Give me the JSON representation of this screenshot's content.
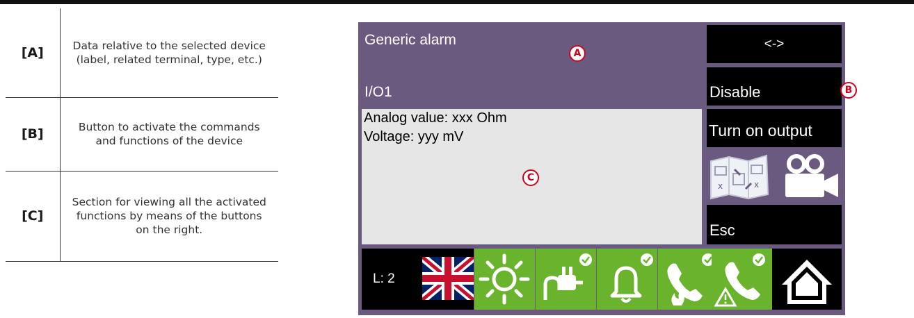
{
  "legend": [
    {
      "key": "[A]",
      "description": "Data relative to the selected device (label, related terminal, type, etc.)"
    },
    {
      "key": "[B]",
      "description": "Button to activate the commands and functions of the device"
    },
    {
      "key": "[C]",
      "description": "Section for viewing all the activated functions by means of the buttons on the right."
    }
  ],
  "screen": {
    "device_label": "Generic alarm",
    "terminal": "I/O1",
    "info_lines": [
      "Analog value: xxx Ohm",
      "Voltage: yyy mV"
    ],
    "buttons": {
      "arrow": "<->",
      "disable": "Disable",
      "turn_on_output": "Turn on output",
      "esc": "Esc"
    },
    "icons": {
      "map": "map-icon",
      "camera": "video-camera-icon"
    },
    "status_bar": {
      "level": "L: 2",
      "flag": "uk-flag-icon",
      "tiles": [
        "sun-icon",
        "power-plug-icon",
        "bell-icon",
        "phone-fire-icon",
        "phone-warning-icon"
      ],
      "home": "home-icon"
    }
  },
  "callouts": {
    "a": "A",
    "b": "B",
    "c": "C"
  },
  "colors": {
    "screen_bg": "#6b5a80",
    "info_bg": "#e6e6e6",
    "tile_green": "#6ab42d",
    "callout_red": "#d0021b"
  }
}
